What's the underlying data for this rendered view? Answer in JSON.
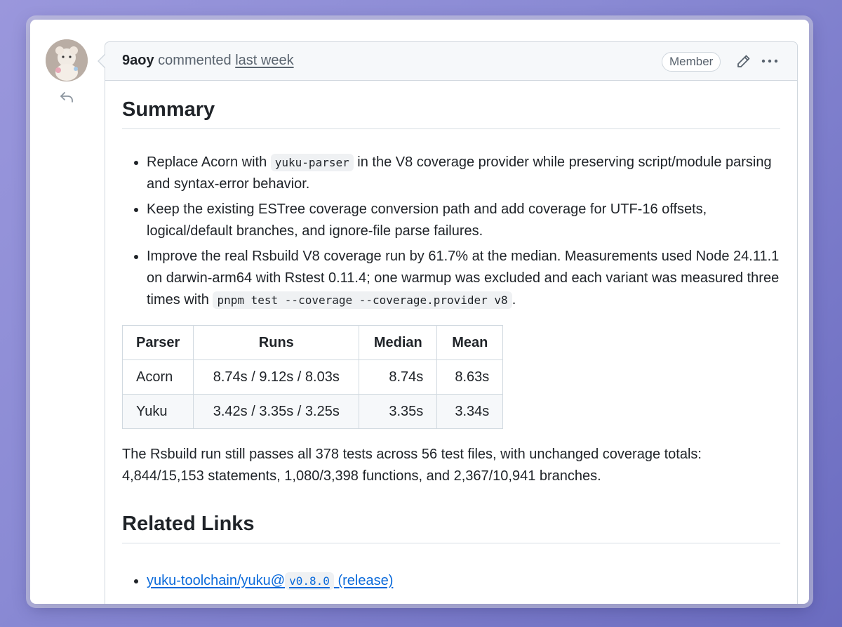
{
  "comment": {
    "author": "9aoy",
    "action": "commented",
    "time": "last week",
    "badge": "Member"
  },
  "icons": {
    "reply": "reply-icon",
    "edit": "pencil-icon",
    "more": "kebab-horizontal-icon"
  },
  "summary": {
    "heading": "Summary",
    "bullets": [
      {
        "pre": "Replace Acorn with",
        "code": "yuku-parser",
        "post": "in the V8 coverage provider while preserving script/module parsing and syntax-error behavior."
      },
      {
        "text": "Keep the existing ESTree coverage conversion path and add coverage for UTF-16 offsets, logical/default branches, and ignore-file parse failures."
      },
      {
        "pre": "Improve the real Rsbuild V8 coverage run by 61.7% at the median. Measurements used Node 24.11.1 on darwin-arm64 with Rstest 0.11.4; one warmup was excluded and each variant was measured three times with",
        "code": "pnpm test --coverage --coverage.provider v8",
        "post": "."
      }
    ]
  },
  "table": {
    "headers": [
      "Parser",
      "Runs",
      "Median",
      "Mean"
    ],
    "rows": [
      [
        "Acorn",
        "8.74s / 9.12s / 8.03s",
        "8.74s",
        "8.63s"
      ],
      [
        "Yuku",
        "3.42s / 3.35s / 3.25s",
        "3.35s",
        "3.34s"
      ]
    ]
  },
  "paragraph": "The Rsbuild run still passes all 378 tests across 56 test files, with unchanged coverage totals: 4,844/15,153 statements, 1,080/3,398 functions, and 2,367/10,941 branches.",
  "related": {
    "heading": "Related Links",
    "links": [
      {
        "pre": "yuku-toolchain/yuku@",
        "code": "v0.8.0",
        "post": "(release)"
      }
    ]
  },
  "colors": {
    "link": "#0969da",
    "border": "#d0d7de",
    "header_bg": "#f6f8fa",
    "text": "#1f2328",
    "muted": "#59636e"
  }
}
